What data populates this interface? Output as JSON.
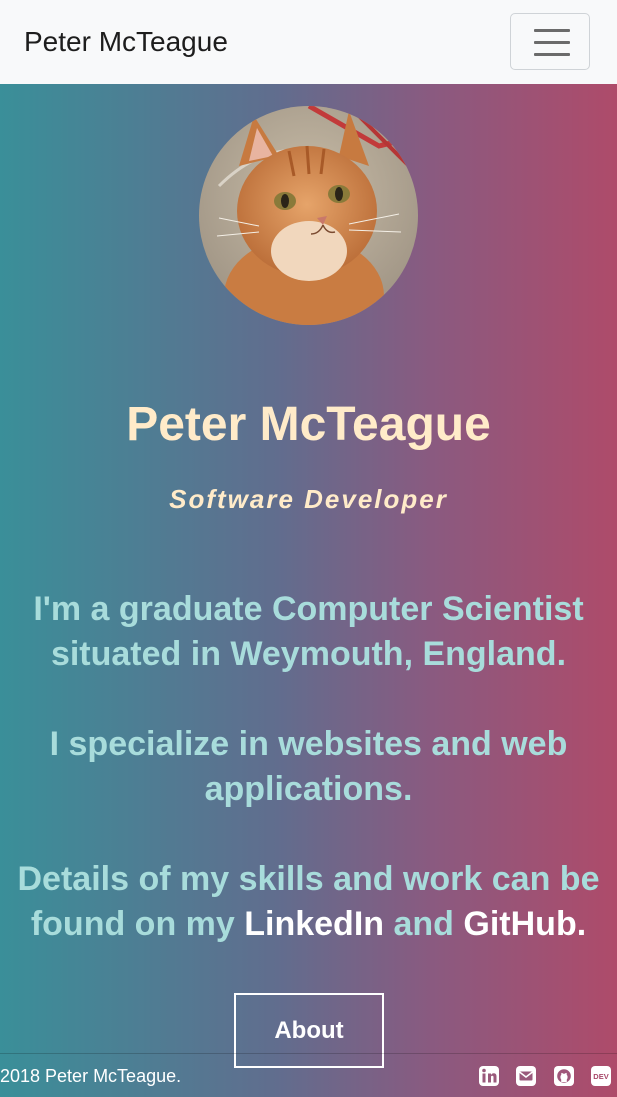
{
  "navbar": {
    "brand": "Peter McTeague",
    "menu_icon": "hamburger-menu-icon"
  },
  "hero": {
    "avatar_alt": "orange tabby cat photo",
    "name": "Peter McTeague",
    "role": "Software Developer"
  },
  "intro": {
    "p1": "I'm a graduate Computer Scientist situated in Weymouth, England.",
    "p2": "I specialize in websites and web applications.",
    "p3_prefix": "Details of my skills and work can be found on my",
    "p3_link_linkedin": "LinkedIn",
    "p3_and": "and",
    "p3_link_github": "GitHub",
    "p3_suffix": "."
  },
  "about_button": "About",
  "footer": {
    "copyright": "2018 Peter McTeague.",
    "social_icons": [
      "linkedin-icon",
      "email-icon",
      "github-icon",
      "dev-icon"
    ],
    "dev_label": "DEV"
  },
  "colors": {
    "navbar_bg": "#f8f9fa",
    "gradient_left": "#3a8f99",
    "gradient_right": "#ae4b6a",
    "heading": "#ffebc9",
    "body_text": "#a8dcdb",
    "link": "#ffffff"
  }
}
